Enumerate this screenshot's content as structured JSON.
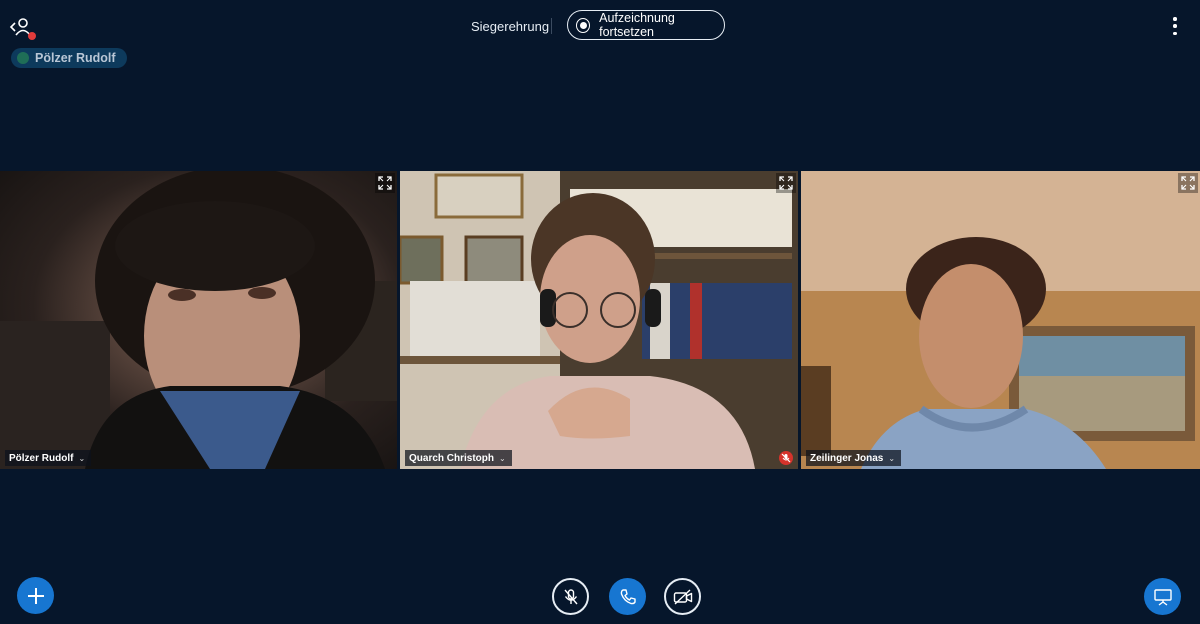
{
  "header": {
    "call_title": "Siegerehrung",
    "record_label": "Aufzeichnung fortsetzen",
    "presence_name": "Pölzer Rudolf"
  },
  "tiles": [
    {
      "name": "Pölzer Rudolf",
      "muted": false
    },
    {
      "name": "Quarch Christoph",
      "muted": true
    },
    {
      "name": "Zeilinger Jonas",
      "muted": false
    }
  ],
  "controls": {
    "add": "plus-icon",
    "mic": "mic-muted-icon",
    "call": "phone-icon",
    "camera": "camera-off-icon",
    "share": "share-screen-icon"
  },
  "colors": {
    "background": "#06162b",
    "accent": "#1776d1",
    "recording_dot": "#e03b3b",
    "muted_badge": "#d6332b"
  }
}
